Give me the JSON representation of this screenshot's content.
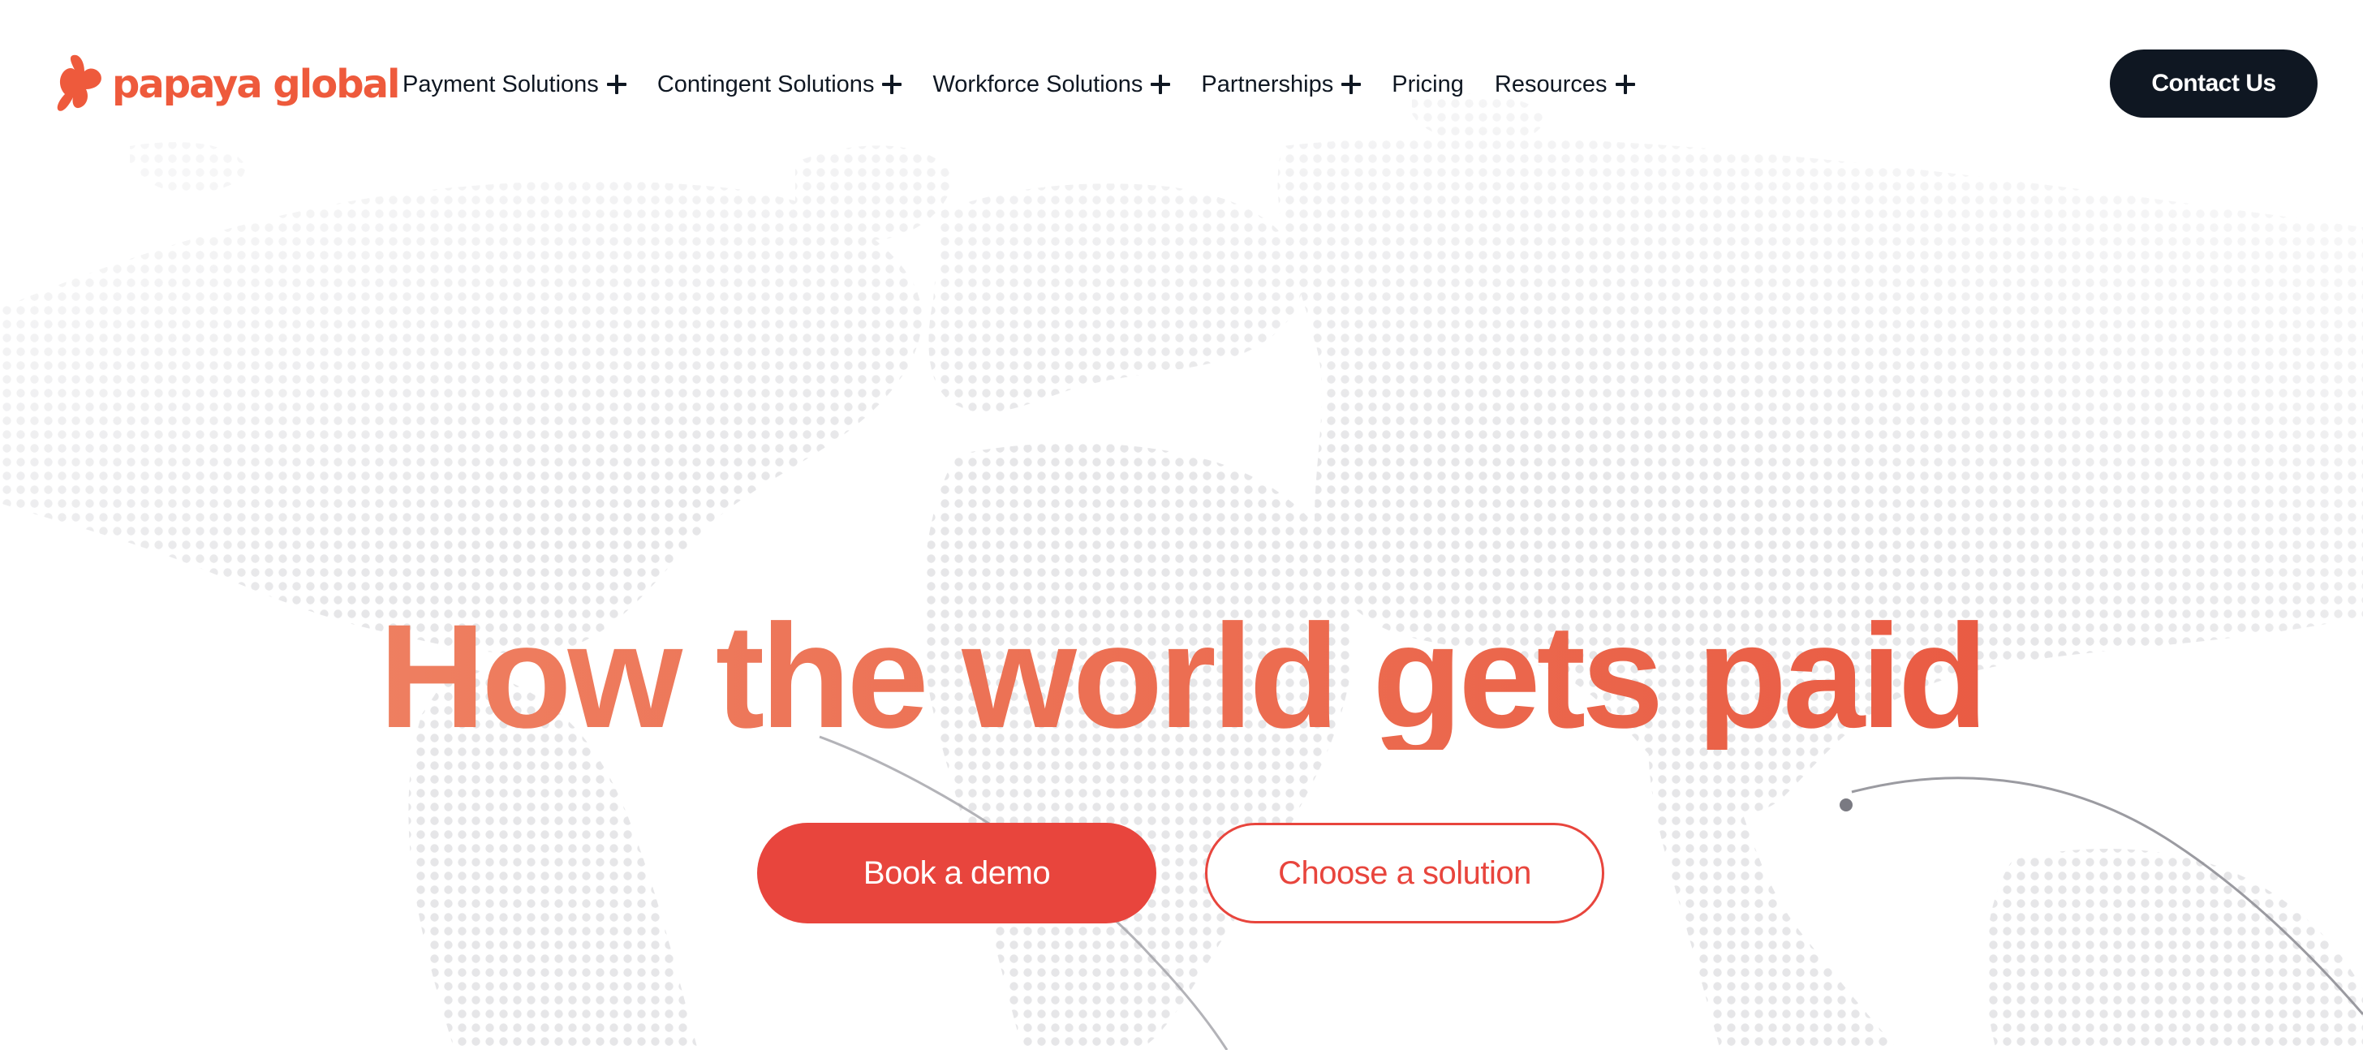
{
  "brand": {
    "name": "papaya global",
    "accent_color": "#ee5a3c",
    "logo_icon": "papaya-butterfly-icon"
  },
  "nav": {
    "items": [
      {
        "label": "Payment Solutions",
        "expandable": true,
        "icon": "plus-icon"
      },
      {
        "label": "Contingent Solutions",
        "expandable": true,
        "icon": "plus-icon"
      },
      {
        "label": "Workforce Solutions",
        "expandable": true,
        "icon": "plus-icon"
      },
      {
        "label": "Partnerships",
        "expandable": true,
        "icon": "plus-icon"
      },
      {
        "label": "Pricing",
        "expandable": false
      },
      {
        "label": "Resources",
        "expandable": true,
        "icon": "plus-icon"
      }
    ],
    "contact_label": "Contact Us"
  },
  "hero": {
    "title": "How the world gets paid",
    "primary_cta": "Book a demo",
    "secondary_cta": "Choose a solution"
  },
  "colors": {
    "dark": "#0f1722",
    "cta_red": "#e8453d",
    "title_gradient_start": "#ef8767",
    "title_gradient_end": "#e8533d",
    "dot_gray": "#e6e6e8"
  }
}
